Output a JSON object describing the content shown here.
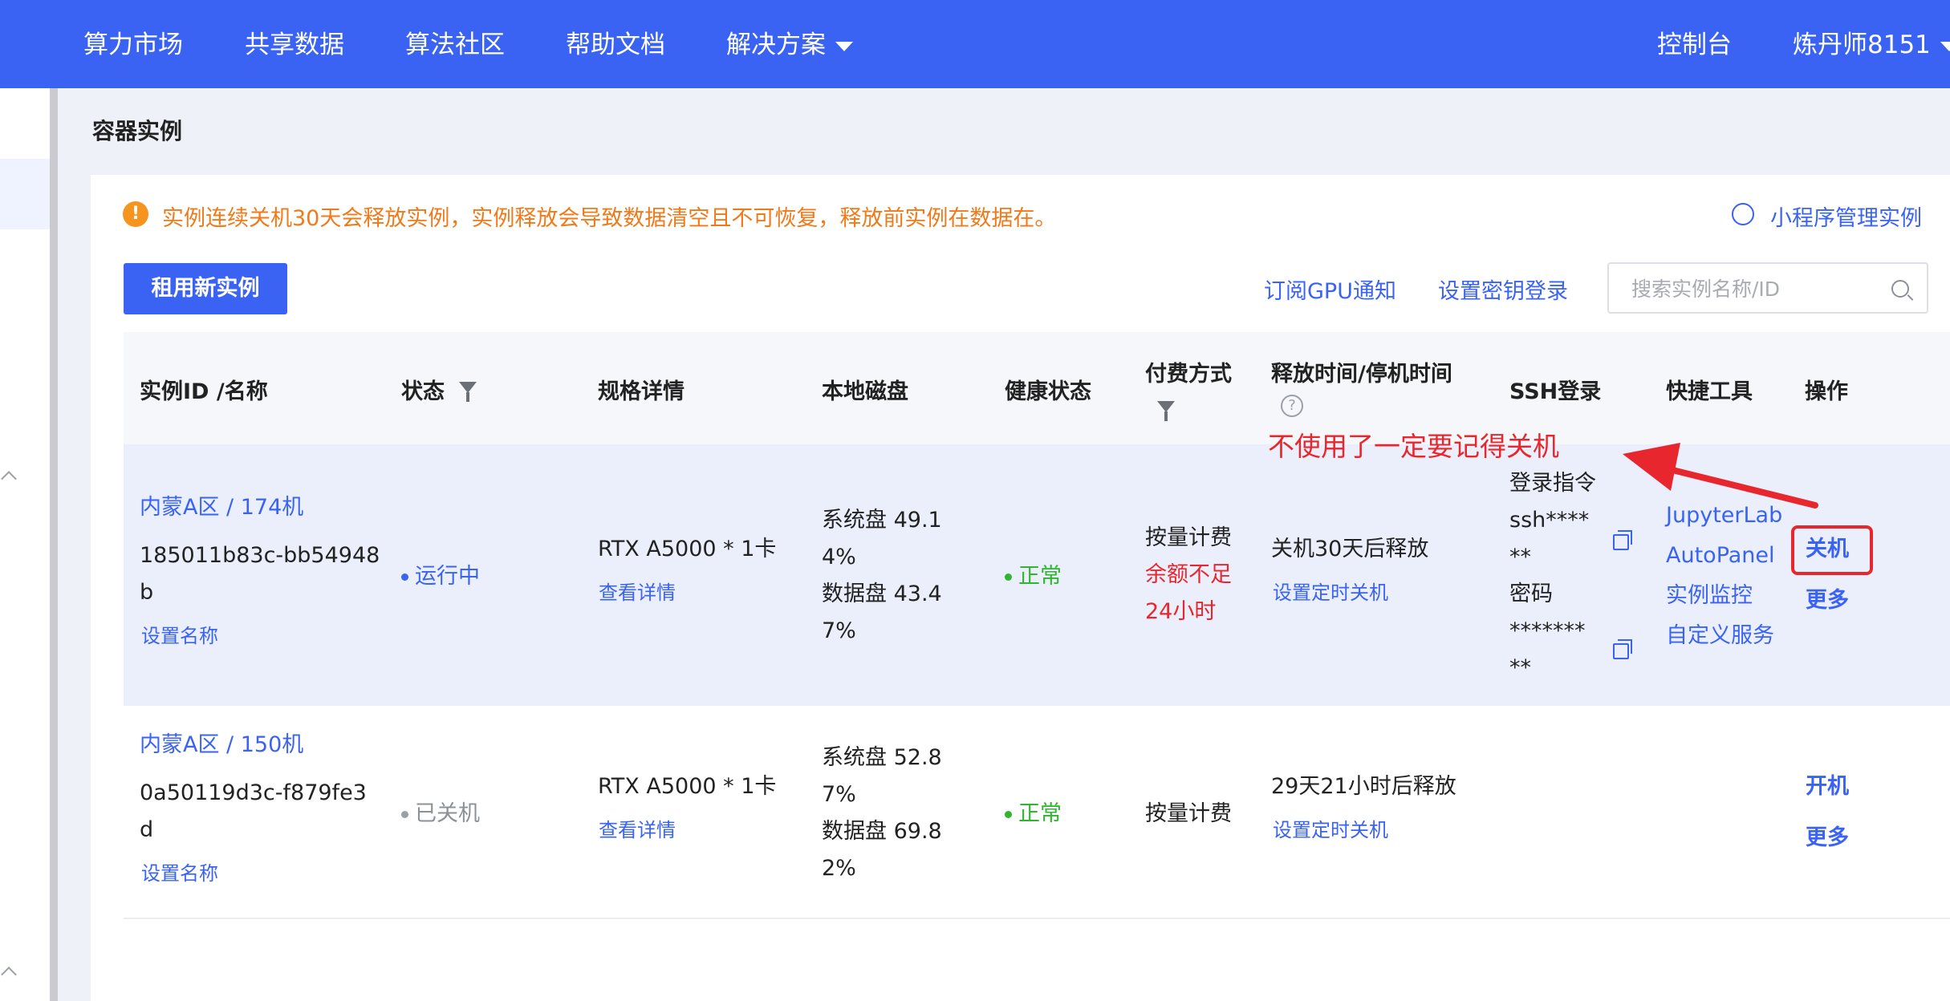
{
  "nav": {
    "items": [
      "算力市场",
      "共享数据",
      "算法社区",
      "帮助文档",
      "解决方案"
    ],
    "console": "控制台",
    "user": "炼丹师8151"
  },
  "page": {
    "title": "容器实例",
    "notice": "实例连续关机30天会释放实例，实例释放会导致数据清空且不可恢复，释放前实例在数据在。",
    "mini_program_link": "小程序管理实例",
    "new_instance_button": "租用新实例",
    "subscribe_gpu_link": "订阅GPU通知",
    "ssh_key_link": "设置密钥登录",
    "search_placeholder": "搜索实例名称/ID"
  },
  "table": {
    "headers": {
      "id_name": "实例ID /名称",
      "status": "状态",
      "spec": "规格详情",
      "disk": "本地磁盘",
      "health": "健康状态",
      "billing": "付费方式",
      "release": "释放时间/停机时间",
      "ssh": "SSH登录",
      "tools": "快捷工具",
      "ops": "操作"
    },
    "rows": [
      {
        "region": "内蒙A区 / 174机",
        "id_line1": "185011b83c-bb54948",
        "id_line2": "b",
        "set_name": "设置名称",
        "status": "运行中",
        "spec": "RTX A5000 * 1卡",
        "spec_detail": "查看详情",
        "disk_l1": "系统盘 49.1",
        "disk_l2": "4%",
        "disk_l3": "数据盘 43.4",
        "disk_l4": "7%",
        "health": "正常",
        "billing": "按量计费",
        "billing_warn1": "余额不足",
        "billing_warn2": "24小时",
        "release": "关机30天后释放",
        "timer": "设置定时关机",
        "ssh_l1": "登录指令",
        "ssh_l2": "ssh****",
        "ssh_l3": "**",
        "ssh_l4": "密码",
        "ssh_l5": "*******",
        "ssh_l6": "**",
        "tools": [
          "JupyterLab",
          "AutoPanel",
          "实例监控",
          "自定义服务"
        ],
        "op_main": "关机",
        "op_more": "更多"
      },
      {
        "region": "内蒙A区 / 150机",
        "id_line1": "0a50119d3c-f879fe3",
        "id_line2": "d",
        "set_name": "设置名称",
        "status": "已关机",
        "spec": "RTX A5000 * 1卡",
        "spec_detail": "查看详情",
        "disk_l1": "系统盘 52.8",
        "disk_l2": "7%",
        "disk_l3": "数据盘 69.8",
        "disk_l4": "2%",
        "health": "正常",
        "billing": "按量计费",
        "release": "29天21小时后释放",
        "timer": "设置定时关机",
        "op_main": "开机",
        "op_more": "更多"
      }
    ]
  },
  "annotation": "不使用了一定要记得关机",
  "colors": {
    "brand": "#3a63f4",
    "warning": "#f07a1a",
    "danger": "#e8262d",
    "success": "#2fb52f"
  }
}
